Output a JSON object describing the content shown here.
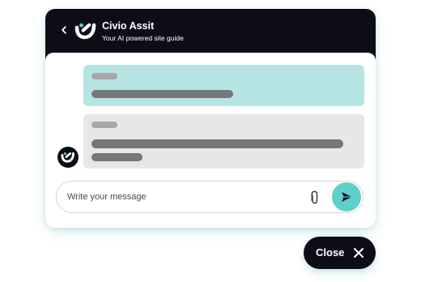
{
  "header": {
    "title": "Civio Assit",
    "subtitle": "Your AI powered site guide",
    "back_icon": "chevron-left-icon",
    "logo": "civio-logo"
  },
  "conversation": {
    "messages": [
      {
        "role": "user",
        "content": "placeholder-lines"
      },
      {
        "role": "assistant",
        "content": "placeholder-lines"
      }
    ]
  },
  "composer": {
    "placeholder": "Write your message",
    "value": "",
    "attach_icon": "paperclip-icon",
    "send_icon": "send-icon"
  },
  "launcher": {
    "close_label": "Close",
    "close_icon": "close-icon"
  },
  "colors": {
    "header_bg": "#0d0d17",
    "accent": "#5fcfca",
    "user_bubble": "#b6e4e3",
    "assistant_bubble": "#e7e7e9",
    "placeholder_dark": "#757779",
    "placeholder_light": "#a8a8ac"
  }
}
